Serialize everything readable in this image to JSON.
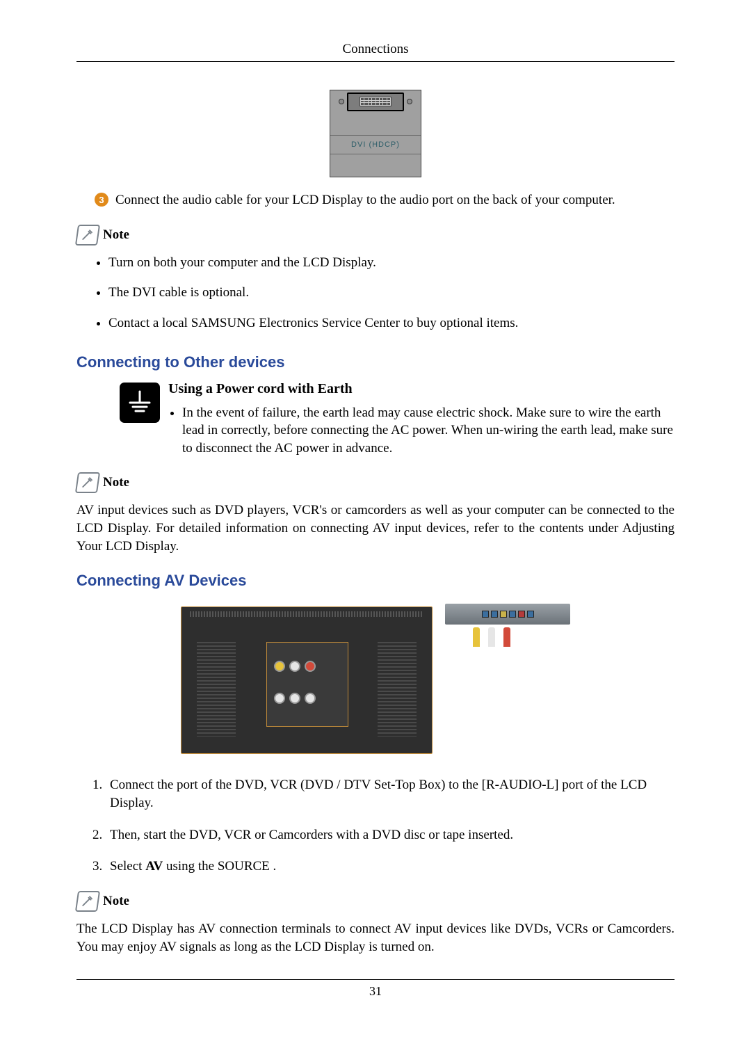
{
  "header": {
    "title": "Connections"
  },
  "port_figure": {
    "label": "DVI (HDCP)"
  },
  "step3": {
    "badge": "3",
    "text": "Connect the audio cable for your LCD Display to the audio port on the back of your computer."
  },
  "note_label": "Note",
  "note1_items": [
    "Turn on both your computer and the LCD Display.",
    "The DVI cable is optional.",
    "Contact a local SAMSUNG Electronics Service Center to buy optional items."
  ],
  "sections": {
    "other_devices": "Connecting to Other devices",
    "av_devices": "Connecting AV Devices"
  },
  "earth": {
    "title": "Using a Power cord with Earth",
    "bullet": "In the event of failure, the earth lead may cause electric shock. Make sure to wire the earth lead in correctly, before connecting the AC power. When un-wiring the earth lead, make sure to disconnect the AC power in advance."
  },
  "note2_text": "AV input devices such as DVD players, VCR's or camcorders as well as your computer can be connected to the LCD Display. For detailed information on connecting AV input devices, refer to the contents under Adjusting Your LCD Display.",
  "av_steps": {
    "s1": "Connect the port of the DVD, VCR (DVD / DTV Set-Top Box) to the [R-AUDIO-L] port of the LCD Display.",
    "s2": "Then, start the DVD, VCR or Camcorders with a DVD disc or tape inserted.",
    "s3_a": "Select ",
    "s3_b": "AV",
    "s3_c": " using the SOURCE ."
  },
  "note3_text": "The LCD Display has AV connection terminals to connect AV input devices like DVDs, VCRs or Camcorders. You may enjoy AV signals as long as the LCD Display is turned on.",
  "page_number": "31"
}
